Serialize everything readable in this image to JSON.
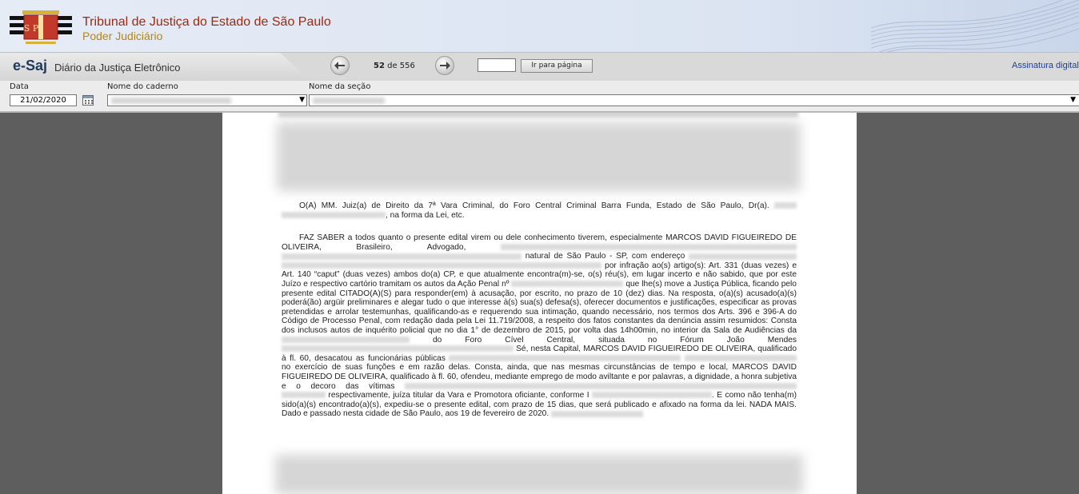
{
  "header": {
    "title": "Tribunal de Justiça do Estado de São Paulo",
    "subtitle": "Poder Judiciário",
    "logo_icon": "tjsp-coat-of-arms-icon",
    "logo_text": "S P"
  },
  "toolbar": {
    "brand_prefix": "e-Saj",
    "brand_name": "Diário da Justiça Eletrônico",
    "prev_icon": "arrow-left-icon",
    "next_icon": "arrow-right-icon",
    "current_page": "52",
    "page_of": "de 556",
    "page_input_value": "",
    "goto_label": "Ir para página",
    "signature_link": "Assinatura digital"
  },
  "filters": {
    "date_label": "Data",
    "date_value": "21/02/2020",
    "calendar_icon": "calendar-icon",
    "caderno_label": "Nome do caderno",
    "secao_label": "Nome da seção"
  },
  "document": {
    "para1": "O(A) MM. Juiz(a) de Direito da 7ª Vara Criminal, do Foro Central Criminal Barra Funda, Estado de São Paulo, Dr(a).",
    "para1_end": ", na forma da Lei, etc.",
    "p2_a": "FAZ SABER a todos quanto o presente edital virem ou dele conhecimento tiverem, especialmente MARCOS DAVID FIGUEIREDO DE OLIVEIRA, Brasileiro, Advogado,",
    "p2_b": "natural de São Paulo - SP, com endereço",
    "p2_c": "por infração ao(s) artigo(s): Art. 331 (duas vezes) e Art. 140 “caput” (duas vezes) ambos do(a) CP, e que atualmente encontra(m)-se, o(s) réu(s), em lugar incerto e não sabido, que por este Juízo e respectivo cartório tramitam os autos da Ação Penal nº",
    "p2_d": "que lhe(s) move a Justiça Pública, ficando pelo presente edital CITADO(A)(S) para responder(em) à acusação, por escrito, no prazo de 10 (dez) dias. Na resposta, o(a)(s) acusado(a)(s) poderá(ão) argüir preliminares e alegar tudo o que interesse à(s) sua(s) defesa(s), oferecer documentos e justificações, especificar as provas pretendidas e arrolar testemunhas, qualificando-as e requerendo sua intimação, quando necessário, nos termos dos Arts. 396 e 396-A do Código de Processo Penal, com redação dada pela Lei 11.719/2008, a respeito dos fatos constantes da denúncia assim resumidos: Consta dos inclusos autos de inquérito policial que no dia 1° de dezembro de 2015, por volta das 14h00min, no interior da Sala de Audiências da",
    "p2_e": "do Foro Cível Central, situada no Fórum João Mendes",
    "p2_f": "Sé, nesta Capital, MARCOS DAVID FIGUEIREDO DE OLIVEIRA, qualificado à fl. 60, desacatou as funcionárias públicas",
    "p2_g": "no exercício de suas funções e em razão delas. Consta, ainda, que nas mesmas circunstâncias de tempo e local, MARCOS DAVID FIGUEIREDO DE OLIVEIRA, qualificado à fl. 60, ofendeu, mediante emprego de modo aviltante e por palavras, a dignidade, a honra subjetiva e o decoro das vítimas",
    "p2_h": "respectivamente, juíza titular da Vara e Promotora oficiante, conforme I",
    "p2_i": ". E como não tenha(m) sido(a)(s) encontrado(a)(s), expediu-se o presente edital, com prazo de 15 dias, que será publicado e afixado na forma da lei. NADA MAIS. Dado e passado nesta cidade de São Paulo, aos 19 de fevereiro de 2020."
  },
  "colors": {
    "title": "#9a2a10",
    "subtitle": "#b8860b",
    "link": "#1f3f8f",
    "viewer_bg": "#5e5e5e"
  }
}
